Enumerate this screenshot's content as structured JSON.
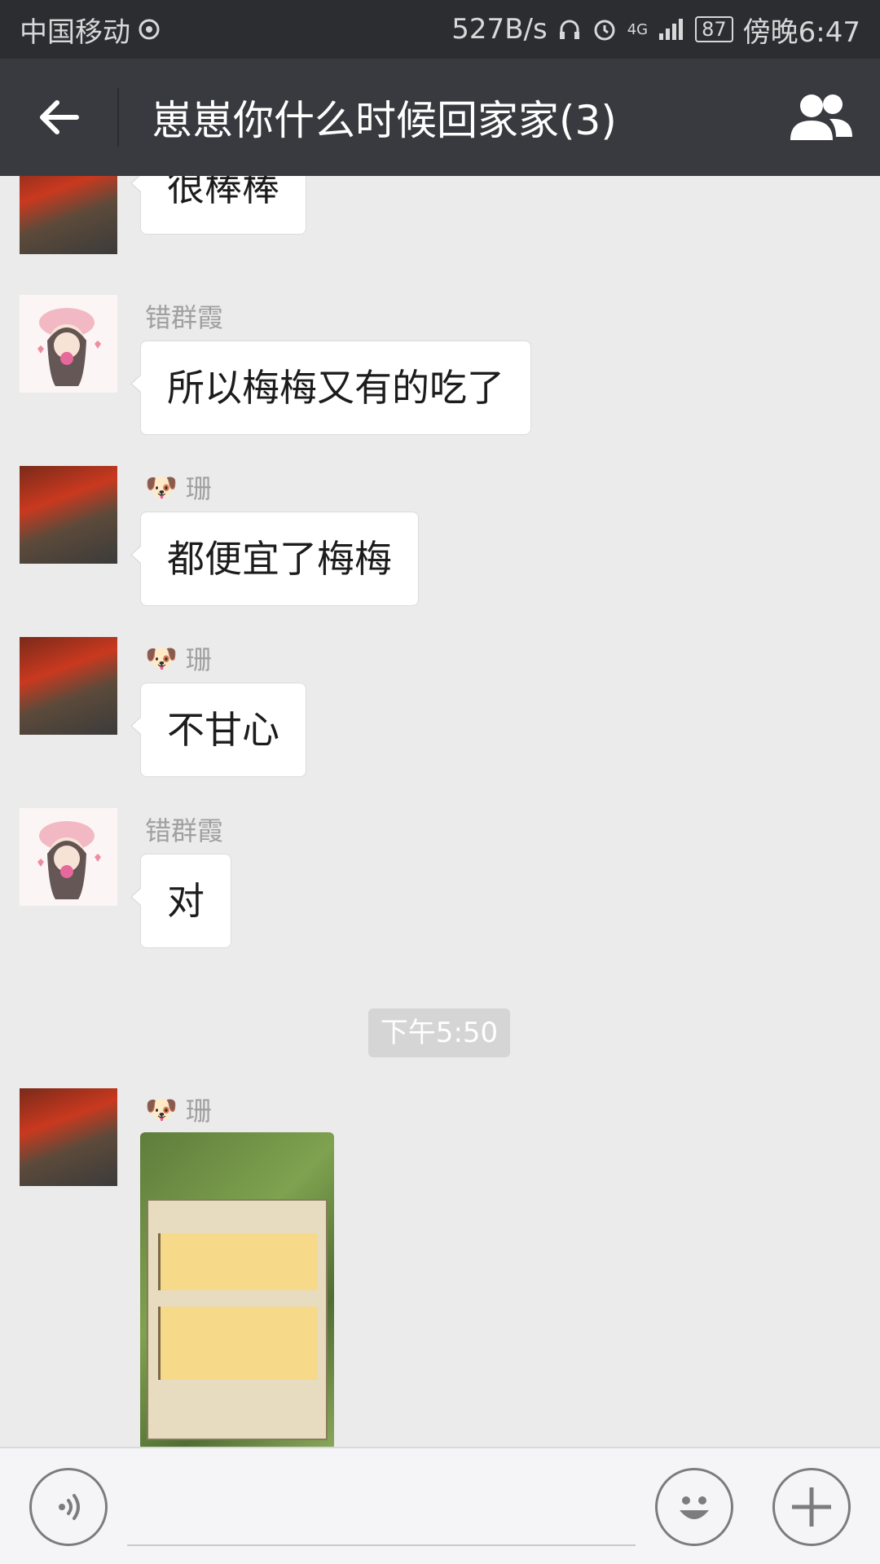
{
  "status_bar": {
    "carrier": "中国移动",
    "net_speed": "527B/s",
    "network": "4G",
    "battery": "87",
    "time": "傍晚6:47"
  },
  "header": {
    "title": "崽崽你什么时候回家家(3)",
    "back_icon": "back-arrow-icon",
    "members_icon": "group-members-icon"
  },
  "messages": [
    {
      "sender": "",
      "text": "很棒棒",
      "avatar": "photo"
    },
    {
      "sender": "错群霞",
      "text": "所以梅梅又有的吃了",
      "avatar": "girl"
    },
    {
      "sender": "珊",
      "sender_emoji": "🐶",
      "text": "都便宜了梅梅",
      "avatar": "photo"
    },
    {
      "sender": "珊",
      "sender_emoji": "🐶",
      "text": "不甘心",
      "avatar": "photo"
    },
    {
      "sender": "错群霞",
      "text": "对",
      "avatar": "girl"
    }
  ],
  "timestamp": "下午5:50",
  "image_message": {
    "sender": "珊",
    "sender_emoji": "🐶",
    "avatar": "photo"
  },
  "input_bar": {
    "placeholder": "",
    "voice_icon": "voice-icon",
    "emoji_icon": "emoji-icon",
    "plus_icon": "plus-icon"
  }
}
